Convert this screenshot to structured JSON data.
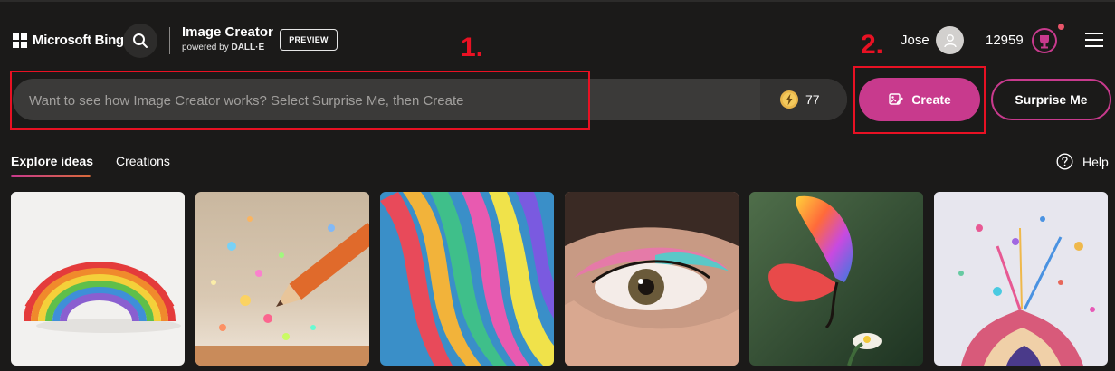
{
  "header": {
    "brand": "Microsoft Bing",
    "app_title": "Image Creator",
    "powered_by": "powered by",
    "model": "DALL·E",
    "badge": "PREVIEW",
    "user_name": "Jose",
    "points": "12959",
    "icons": [
      "microsoft-logo",
      "search-icon",
      "avatar-icon",
      "rewards-icon",
      "menu-icon"
    ]
  },
  "prompt": {
    "placeholder": "Want to see how Image Creator works? Select Surprise Me, then Create",
    "value": "",
    "boost_count": "77"
  },
  "actions": {
    "create_label": "Create",
    "surprise_label": "Surprise Me"
  },
  "annotations": {
    "label_1": "1.",
    "label_2": "2.",
    "color": "#e81123"
  },
  "tabs": [
    {
      "label": "Explore ideas",
      "active": true
    },
    {
      "label": "Creations",
      "active": false
    }
  ],
  "help_label": "Help",
  "gallery": [
    {
      "subject": "paper rainbow"
    },
    {
      "subject": "pencil with glitter"
    },
    {
      "subject": "colorful ribbons"
    },
    {
      "subject": "eye with colorful makeup"
    },
    {
      "subject": "rainbow butterfly"
    },
    {
      "subject": "paint splash"
    }
  ],
  "colors": {
    "background": "#1b1a19",
    "accent": "#c83a8d",
    "prompt_bg": "#3b3a39"
  }
}
